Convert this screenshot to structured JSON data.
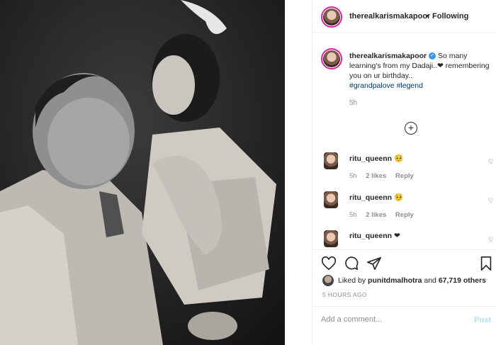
{
  "header": {
    "username": "therealkarismakapoor",
    "separator": "•",
    "follow_status": "Following"
  },
  "caption": {
    "username": "therealkarismakapoor",
    "verified_glyph": "✓",
    "text": "So many learning's from my Dadaji..❤ remembering you on ur birthday..",
    "hashtags": [
      "#grandpalove",
      "#legend"
    ],
    "time": "5h"
  },
  "load_more_glyph": "+",
  "comments": [
    {
      "username": "ritu_queenn",
      "text": "🥺",
      "time": "5h",
      "likes": "2 likes",
      "reply": "Reply",
      "like_icon": "heart-outline-icon",
      "like_glyph": "♡"
    },
    {
      "username": "ritu_queenn",
      "text": "🥺",
      "time": "5h",
      "likes": "2 likes",
      "reply": "Reply",
      "like_icon": "heart-outline-icon",
      "like_glyph": "♡"
    },
    {
      "username": "ritu_queenn",
      "text": "❤",
      "like_icon": "heart-outline-icon",
      "like_glyph": "♡"
    }
  ],
  "actions": {
    "icons": [
      "heart-icon",
      "comment-icon",
      "share-icon",
      "bookmark-icon"
    ]
  },
  "likes": {
    "prefix": "Liked by",
    "user": "punitdmalhotra",
    "connector": "and",
    "count": "67,719 others"
  },
  "time_ago": "5 HOURS AGO",
  "add_comment": {
    "placeholder": "Add a comment...",
    "post_label": "Post"
  },
  "colors": {
    "link": "#00376b",
    "verified": "#3897f0",
    "muted": "#8e8e8e",
    "post_disabled": "#b2dffc",
    "story_ring": "#d6249f"
  }
}
